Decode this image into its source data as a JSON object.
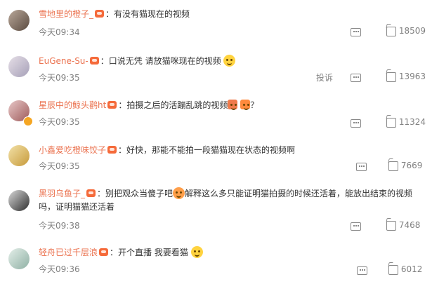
{
  "comments": [
    {
      "username": "雪地里的橙子_",
      "colon": "：",
      "text": "有没有猫现在的视频",
      "time": "今天09:34",
      "likes": "18509",
      "report": ""
    },
    {
      "username": "EuGene-Su-",
      "colon": "：",
      "text": "口说无凭 请放猫咪现在的视频",
      "time": "今天09:35",
      "likes": "13963",
      "report": "投诉"
    },
    {
      "username": "星辰中的鲸头鹳ht",
      "colon": "：",
      "text": "拍摄之后的活蹦乱跳的视频",
      "text_after": "？",
      "time": "今天09:35",
      "likes": "11324",
      "report": ""
    },
    {
      "username": "小鑫爱吃橙味饺子",
      "colon": "：",
      "text": "好快，那能不能拍一段猫猫现在状态的视频啊",
      "time": "今天09:35",
      "likes": "7669",
      "report": ""
    },
    {
      "username": "黑羽乌鱼子_",
      "colon": "：",
      "text": "别把观众当傻子吧",
      "text_after": "解释这么多只能证明猫拍摄的时候还活着，能放出结束的视频吗，证明猫猫还活着",
      "time": "今天09:38",
      "likes": "7468",
      "report": ""
    },
    {
      "username": "轻舟已过千层浪",
      "colon": "：",
      "text": "开个直播 我要看猫",
      "time": "今天09:36",
      "likes": "6012",
      "report": ""
    }
  ],
  "icons": {
    "comment": "comment-icon",
    "like": "thumbs-up-icon",
    "fan_badge": "fan-badge-icon",
    "emoji": "emoji-icon"
  },
  "colors": {
    "username": "#eb7350",
    "meta": "#808080"
  }
}
